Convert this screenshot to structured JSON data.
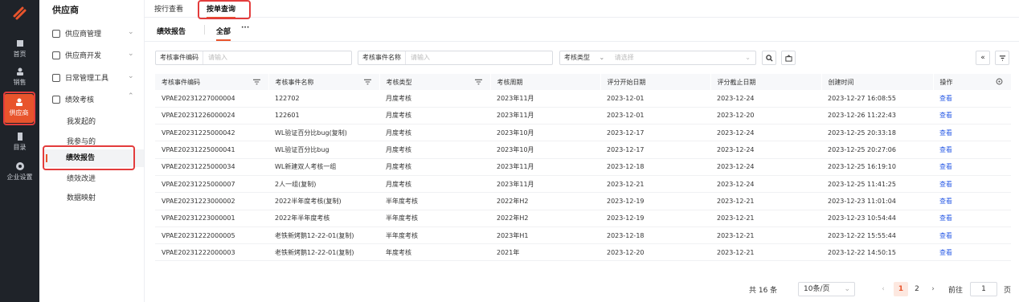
{
  "nav": {
    "items": [
      {
        "label": "首页"
      },
      {
        "label": "销售"
      },
      {
        "label": "供应商"
      },
      {
        "label": "目录"
      },
      {
        "label": "企业设置"
      }
    ]
  },
  "sidebar": {
    "title": "供应商",
    "groups": [
      {
        "label": "供应商管理"
      },
      {
        "label": "供应商开发"
      },
      {
        "label": "日常管理工具"
      },
      {
        "label": "绩效考核"
      }
    ],
    "subs": [
      {
        "label": "我发起的"
      },
      {
        "label": "我参与的"
      },
      {
        "label": "绩效报告"
      },
      {
        "label": "绩效改进"
      },
      {
        "label": "数据映射"
      }
    ]
  },
  "tabs": [
    {
      "label": "按行查看"
    },
    {
      "label": "按单查询"
    }
  ],
  "subtabs": {
    "report": "绩效报告",
    "all": "全部",
    "more": "···"
  },
  "filters": {
    "code_label": "考核事件编码",
    "code_placeholder": "请输入",
    "name_label": "考核事件名称",
    "name_placeholder": "请输入",
    "type_label": "考核类型",
    "type_placeholder": "请选择"
  },
  "table": {
    "headers": [
      "考核事件编码",
      "考核事件名称",
      "考核类型",
      "考核周期",
      "评分开始日期",
      "评分截止日期",
      "创建时间",
      "操作"
    ],
    "rows": [
      [
        "VPAE20231227000004",
        "122702",
        "月度考核",
        "2023年11月",
        "2023-12-01",
        "2023-12-24",
        "2023-12-27 16:08:55",
        "查看"
      ],
      [
        "VPAE20231226000024",
        "122601",
        "月度考核",
        "2023年11月",
        "2023-12-01",
        "2023-12-20",
        "2023-12-26 11:22:43",
        "查看"
      ],
      [
        "VPAE20231225000042",
        "WL验证百分比bug(复制)",
        "月度考核",
        "2023年10月",
        "2023-12-17",
        "2023-12-24",
        "2023-12-25 20:33:18",
        "查看"
      ],
      [
        "VPAE20231225000041",
        "WL验证百分比bug",
        "月度考核",
        "2023年10月",
        "2023-12-17",
        "2023-12-24",
        "2023-12-25 20:27:06",
        "查看"
      ],
      [
        "VPAE20231225000034",
        "WL新建双人考核一组",
        "月度考核",
        "2023年11月",
        "2023-12-18",
        "2023-12-24",
        "2023-12-25 16:19:10",
        "查看"
      ],
      [
        "VPAE20231225000007",
        "2人一组(复制)",
        "月度考核",
        "2023年11月",
        "2023-12-21",
        "2023-12-24",
        "2023-12-25 11:41:25",
        "查看"
      ],
      [
        "VPAE20231223000002",
        "2022半年度考核(复制)",
        "半年度考核",
        "2022年H2",
        "2023-12-19",
        "2023-12-21",
        "2023-12-23 11:01:04",
        "查看"
      ],
      [
        "VPAE20231223000001",
        "2022年半年度考核",
        "半年度考核",
        "2022年H2",
        "2023-12-19",
        "2023-12-21",
        "2023-12-23 10:54:44",
        "查看"
      ],
      [
        "VPAE20231222000005",
        "老铁新烤鹅12-22-01(复制)",
        "半年度考核",
        "2023年H1",
        "2023-12-18",
        "2023-12-21",
        "2023-12-22 15:55:44",
        "查看"
      ],
      [
        "VPAE20231222000003",
        "老铁新烤鹅12-22-01(复制)",
        "年度考核",
        "2021年",
        "2023-12-20",
        "2023-12-21",
        "2023-12-22 14:50:15",
        "查看"
      ]
    ]
  },
  "pager": {
    "total": "共 16 条",
    "size": "10条/页",
    "page1": "1",
    "page2": "2",
    "goto": "前往",
    "goto_value": "1",
    "page_unit": "页",
    "prev": "‹",
    "next": "›"
  },
  "colors": {
    "accent": "#e8542c",
    "link": "#2b5ce6",
    "highlight": "#e33c3c"
  }
}
